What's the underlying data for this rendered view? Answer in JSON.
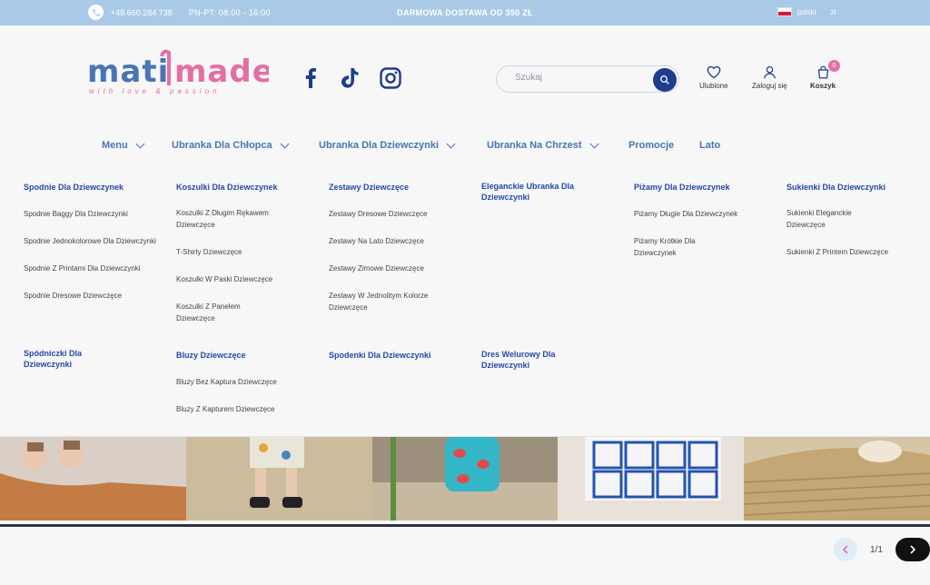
{
  "topbar": {
    "phone": "+48 660 284 738",
    "hours": "PN-PT: 08:00 - 16:00",
    "promo": "DARMOWA DOSTAWA OD 350 ZŁ",
    "language": "polski",
    "currency": "zł"
  },
  "logo": {
    "tagline": "with love & passion"
  },
  "search": {
    "placeholder": "Szukaj"
  },
  "header_icons": {
    "favorites": "Ulubione",
    "login": "Zaloguj się",
    "cart": "Koszyk",
    "cart_count": "0"
  },
  "nav": [
    {
      "label": "Menu"
    },
    {
      "label": "Ubranka Dla Chłopca"
    },
    {
      "label": "Ubranka Dla Dziewczynki"
    },
    {
      "label": "Ubranka Na Chrzest"
    },
    {
      "label": "Promocje"
    },
    {
      "label": "Lato"
    }
  ],
  "mega": {
    "row1": [
      {
        "head": "Spodnie Dla Dziewczynek",
        "items": [
          "Spodnie Baggy Dla Dziewczynki",
          "Spodnie Jednokolorowe Dla Dziewczynki",
          "Spodnie Z Printami Dla Dziewczynki",
          "Spodnie Dresowe Dziewczęce"
        ]
      },
      {
        "head": "Koszulki Dla Dziewczynek",
        "items": [
          "Koszulki Z Długim Rękawem Dziewczęce",
          "T-Shirty Dziewczęce",
          "Koszulki W Paski Dziewczęce",
          "Koszulki Z Panelem Dziewczęce"
        ]
      },
      {
        "head": "Zestawy Dziewczęce",
        "items": [
          "Zestawy Dresowe Dziewczęce",
          "Zestawy Na Lato Dziewczęce",
          "Zestawy Zimowe Dziewczęce",
          "Zestawy W Jednolitym Kolorze Dziewczęce"
        ]
      },
      {
        "head": "Eleganckie Ubranka Dla Dziewczynki",
        "items": []
      },
      {
        "head": "Piżamy Dla Dziewczynek",
        "items": [
          "Piżamy Długie Dla Dziewczynek",
          "Piżamy Krótkie Dla Dziewczynek"
        ]
      },
      {
        "head": "Sukienki Dla Dziewczynki",
        "items": [
          "Sukienki Eleganckie Dziewczęce",
          "Sukienki Z Printem Dziewczęce"
        ]
      }
    ],
    "row2": [
      {
        "head": "Spódniczki Dla Dziewczynki",
        "items": []
      },
      {
        "head": "Bluzy Dziewczęce",
        "items": [
          "Bluzy Bez Kaptura Dziewczęce",
          "Bluzy Z Kapturem Dziewczęce"
        ]
      },
      {
        "head": "Spodenki Dla Dziewczynki",
        "items": []
      },
      {
        "head": "Dres Welurowy Dla Dziewczynki",
        "items": []
      }
    ]
  },
  "pager": {
    "count": "1/1"
  },
  "colors": {
    "topbar": "#a9cae6",
    "nav_text": "#4a74b5",
    "menu_head": "#2548a8",
    "accent_pink": "#e36fa4",
    "search_button": "#1f3c8f"
  }
}
